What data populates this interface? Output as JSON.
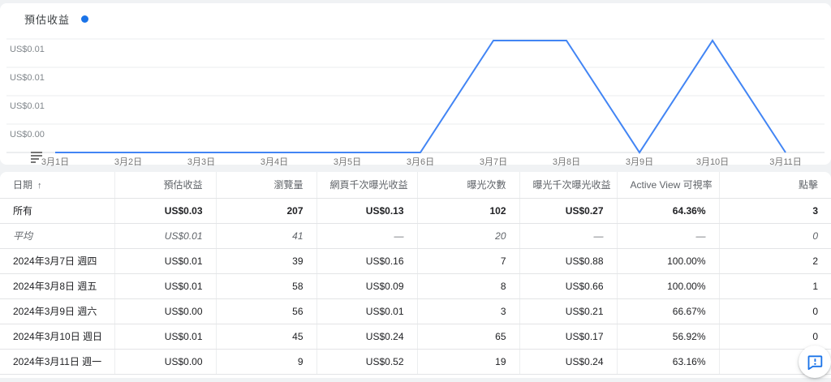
{
  "chart": {
    "title": "預估收益",
    "legend_dot_color": "#1a73e8"
  },
  "chart_data": {
    "type": "line",
    "title": "預估收益",
    "series_name": "預估收益",
    "categories": [
      "3月1日",
      "3月2日",
      "3月3日",
      "3月4日",
      "3月5日",
      "3月6日",
      "3月7日",
      "3月8日",
      "3月9日",
      "3月10日",
      "3月11日"
    ],
    "values": [
      0,
      0,
      0,
      0,
      0,
      0,
      0.01,
      0.01,
      0,
      0.01,
      0
    ],
    "y_axis_labels": [
      "US$0.01",
      "US$0.01",
      "US$0.01",
      "US$0.00"
    ],
    "y_min": 0,
    "y_max": 0.01,
    "ylim": [
      0,
      0.01
    ],
    "grid": true,
    "legend_position": "top-left",
    "line_color": "#4285f4"
  },
  "table": {
    "sort_arrow": "↑",
    "headers": [
      "日期",
      "預估收益",
      "瀏覽量",
      "網頁千次曝光收益",
      "曝光次數",
      "曝光千次曝光收益",
      "Active View 可視率",
      "點擊"
    ],
    "rows": [
      {
        "date": "所有",
        "cells": [
          "US$0.03",
          "207",
          "US$0.13",
          "102",
          "US$0.27",
          "64.36%",
          "3"
        ]
      },
      {
        "date": "平均",
        "cells": [
          "US$0.01",
          "41",
          "—",
          "20",
          "—",
          "—",
          "0"
        ]
      },
      {
        "date": "2024年3月7日 週四",
        "cells": [
          "US$0.01",
          "39",
          "US$0.16",
          "7",
          "US$0.88",
          "100.00%",
          "2"
        ]
      },
      {
        "date": "2024年3月8日 週五",
        "cells": [
          "US$0.01",
          "58",
          "US$0.09",
          "8",
          "US$0.66",
          "100.00%",
          "1"
        ]
      },
      {
        "date": "2024年3月9日 週六",
        "cells": [
          "US$0.00",
          "56",
          "US$0.01",
          "3",
          "US$0.21",
          "66.67%",
          "0"
        ]
      },
      {
        "date": "2024年3月10日 週日",
        "cells": [
          "US$0.01",
          "45",
          "US$0.24",
          "65",
          "US$0.17",
          "56.92%",
          "0"
        ]
      },
      {
        "date": "2024年3月11日 週一",
        "cells": [
          "US$0.00",
          "9",
          "US$0.52",
          "19",
          "US$0.24",
          "63.16%",
          ""
        ]
      }
    ]
  },
  "feedback": {
    "icon_color": "#1a73e8"
  }
}
